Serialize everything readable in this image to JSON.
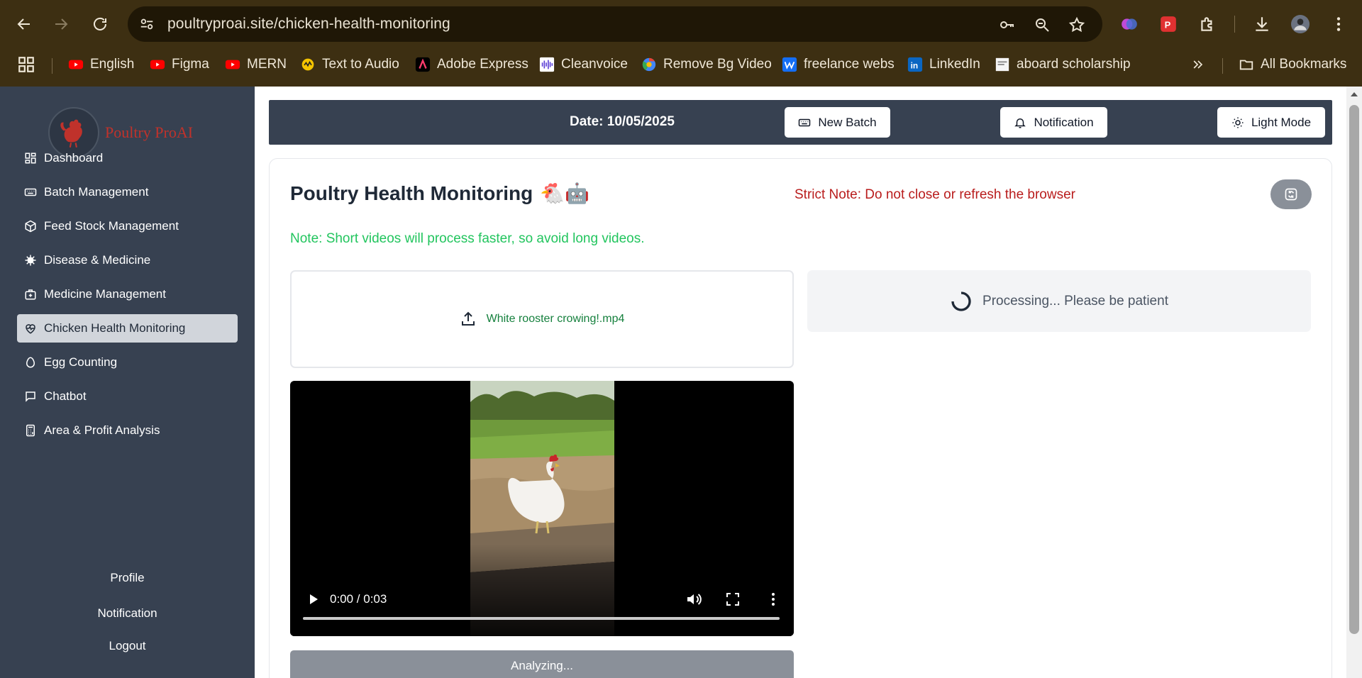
{
  "browser": {
    "url": "poultryproai.site/chicken-health-monitoring",
    "bookmarks": [
      {
        "label": "English",
        "icon": "youtube-icon"
      },
      {
        "label": "Figma",
        "icon": "youtube-icon"
      },
      {
        "label": "MERN",
        "icon": "youtube-icon"
      },
      {
        "label": "Text to Audio",
        "icon": "text-to-audio-icon"
      },
      {
        "label": "Adobe Express",
        "icon": "adobe-express-icon"
      },
      {
        "label": "Cleanvoice",
        "icon": "cleanvoice-icon"
      },
      {
        "label": "Remove Bg Video",
        "icon": "remove-bg-icon"
      },
      {
        "label": "freelance webs",
        "icon": "webflow-icon"
      },
      {
        "label": "LinkedIn",
        "icon": "linkedin-icon"
      },
      {
        "label": "aboard scholarship",
        "icon": "page-icon"
      }
    ],
    "all_bookmarks": "All Bookmarks"
  },
  "sidebar": {
    "logo_text": "Poultry ProAI",
    "items": [
      {
        "label": "Dashboard",
        "icon": "dashboard-icon"
      },
      {
        "label": "Batch Management",
        "icon": "batch-icon"
      },
      {
        "label": "Feed Stock Management",
        "icon": "box-icon"
      },
      {
        "label": "Disease & Medicine",
        "icon": "virus-icon"
      },
      {
        "label": "Medicine Management",
        "icon": "medical-bag-icon"
      },
      {
        "label": "Chicken Health Monitoring",
        "icon": "heart-pulse-icon"
      },
      {
        "label": "Egg Counting",
        "icon": "egg-icon"
      },
      {
        "label": "Chatbot",
        "icon": "chat-icon"
      },
      {
        "label": "Area & Profit Analysis",
        "icon": "calculator-icon"
      }
    ],
    "active_index": 5,
    "bottom": {
      "profile": "Profile",
      "notification": "Notification",
      "logout": "Logout"
    }
  },
  "topbar": {
    "date": "Date: 10/05/2025",
    "new_batch": "New Batch",
    "notification": "Notification",
    "light_mode": "Light Mode"
  },
  "main": {
    "title": "Poultry Health Monitoring",
    "title_emojis": "🐔🤖",
    "strict_note": "Strict Note: Do not close or refresh the browser",
    "short_note": "Note: Short videos will process faster, so avoid long videos.",
    "upload_filename": "White rooster crowing!.mp4",
    "processing_text": "Processing... Please be patient",
    "video_time": "0:00 / 0:03",
    "analyzing_label": "Analyzing..."
  },
  "colors": {
    "sidebar_bg": "#374151",
    "strict_note": "#b91c1c",
    "short_note": "#22c55e",
    "filename": "#15803d",
    "logo_red": "#c0322b"
  }
}
